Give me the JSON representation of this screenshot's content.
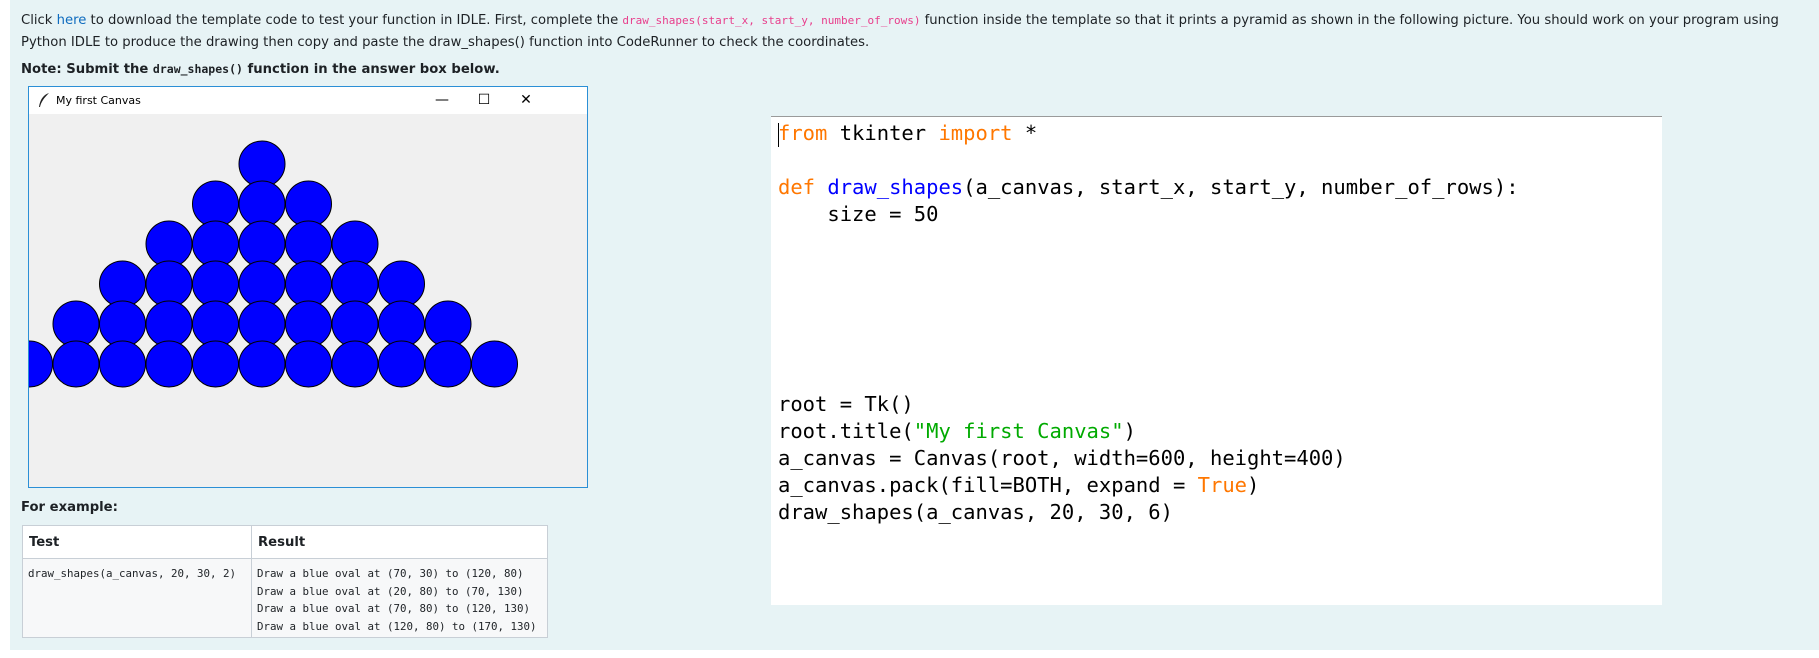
{
  "intro": {
    "part1": "Click ",
    "link": "here",
    "part2": " to download the template code to test your function in IDLE.   First, complete the ",
    "func_sig": "draw_shapes(start_x, start_y, number_of_rows)",
    "part3": " function inside the template so that it prints a pyramid as shown in the following picture. You should work on your program using Python IDLE to produce the drawing then copy and paste the draw_shapes() function into CodeRunner to check the coordinates."
  },
  "note": {
    "prefix": "Note: Submit the ",
    "code": "draw_shapes()",
    "suffix": " function in the answer box below."
  },
  "tk_window": {
    "title": "My first Canvas",
    "minimize": "—",
    "maximize": "☐",
    "close": "✕",
    "circle_color": "#0000ff",
    "rows": 6
  },
  "example": {
    "heading": "For example:",
    "columns": [
      "Test",
      "Result"
    ],
    "test": "draw_shapes(a_canvas, 20, 30, 2)",
    "result": "Draw a blue oval at (70, 30) to (120, 80)\nDraw a blue oval at (20, 80) to (70, 130)\nDraw a blue oval at (70, 80) to (120, 130)\nDraw a blue oval at (120, 80) to (170, 130)"
  },
  "code": {
    "l1_a": "from",
    "l1_b": " tkinter ",
    "l1_c": "import",
    "l1_d": " *",
    "l2_a": "def",
    "l2_b": " ",
    "l2_c": "draw_shapes",
    "l2_d": "(a_canvas, start_x, start_y, number_of_rows):",
    "l3": "    size = 50",
    "l4": "root = Tk()",
    "l5_a": "root.title(",
    "l5_b": "\"My first Canvas\"",
    "l5_c": ")",
    "l6": "a_canvas = Canvas(root, width=600, height=400)",
    "l7_a": "a_canvas.pack(fill=BOTH, expand = ",
    "l7_b": "True",
    "l7_c": ")",
    "l8": "draw_shapes(a_canvas, 20, 30, 6)"
  }
}
